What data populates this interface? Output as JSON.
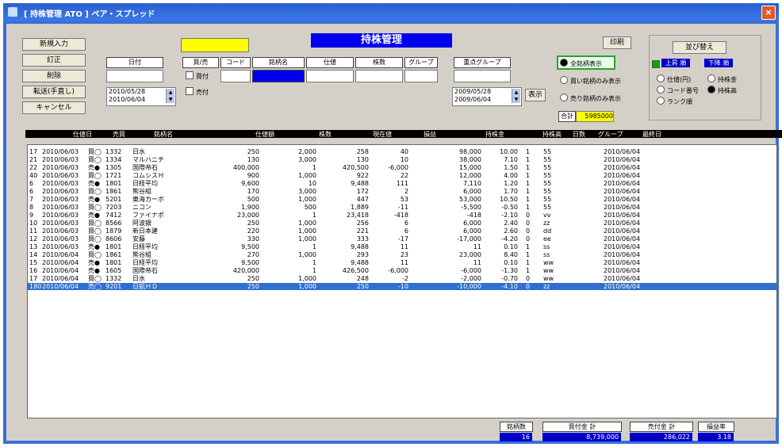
{
  "window": {
    "title": "[ 持株管理 ATO ]   ペア・スプレッド",
    "close": "×"
  },
  "left_buttons": [
    "新規入力",
    "訂正",
    "削除",
    "転送(手直し)",
    "キャンセル"
  ],
  "banner": "持株管理",
  "top_right": {
    "print_label": "印刷",
    "sort_label": "並び替え"
  },
  "filters": {
    "box1_label": "日付",
    "col_labels": [
      "買/売",
      "コード",
      "銘柄名",
      "仕値",
      "株数",
      "グループ"
    ],
    "box_right_label": "重点グループ",
    "check_buy": "買付",
    "check_sell": "売付",
    "date_left": [
      "2010/05/28",
      "2010/06/04"
    ],
    "date_right": [
      "2009/05/28",
      "2009/06/04"
    ],
    "btn_right": "表示"
  },
  "options": {
    "o1": "全銘柄表示",
    "o2": "買い銘柄のみ表示",
    "o3": "売り銘柄のみ表示",
    "sum_label": "合計",
    "sum_value": "5985000"
  },
  "sort_panel": {
    "btn1": "上昇 順",
    "btn2": "下降 順",
    "r1": "仕値(円)",
    "r2": "持株金",
    "r3": "コード番号",
    "r4": "持株高",
    "r5": "ランク順"
  },
  "columns": [
    "仕値日",
    "売買",
    "銘柄名",
    "仕値額",
    "株数",
    "現在値",
    "損益",
    "持株金",
    "持株高",
    "日数",
    "グループ",
    "最終日"
  ],
  "rows": [
    [
      "17",
      "2010/06/03",
      "買◯",
      "1332",
      "日水",
      "250",
      "2,000",
      "258",
      "40",
      "98,000",
      "10.00",
      "1",
      "55",
      "2010/06/04"
    ],
    [
      "21",
      "2010/06/03",
      "買◯",
      "1334",
      "マルハニチ",
      "130",
      "3,000",
      "130",
      "10",
      "38,000",
      "7.10",
      "1",
      "55",
      "2010/06/04"
    ],
    [
      "22",
      "2010/06/03",
      "売●",
      "1305",
      "国際帝石",
      "400,000",
      "1",
      "420,500",
      "-6,000",
      "15,000",
      "1.50",
      "1",
      "55",
      "2010/06/04"
    ],
    [
      "40",
      "2010/06/03",
      "買◯",
      "1721",
      "コムシスＨ",
      "900",
      "1,000",
      "922",
      "22",
      "12,000",
      "4.00",
      "1",
      "55",
      "2010/06/04"
    ],
    [
      "6",
      "2010/06/03",
      "売●",
      "1801",
      "日経平均",
      "9,600",
      "10",
      "9,488",
      "111",
      "7,110",
      "1.20",
      "1",
      "55",
      "2010/06/04"
    ],
    [
      "6",
      "2010/06/03",
      "買◯",
      "1861",
      "熊谷組",
      "170",
      "3,000",
      "172",
      "2",
      "6,000",
      "1.70",
      "1",
      "55",
      "2010/06/04"
    ],
    [
      "7",
      "2010/06/03",
      "売●",
      "5201",
      "東海カーボ",
      "500",
      "1,000",
      "447",
      "53",
      "53,000",
      "10.50",
      "1",
      "55",
      "2010/06/04"
    ],
    [
      "8",
      "2010/06/03",
      "買◯",
      "7203",
      "ニコン",
      "1,900",
      "500",
      "1,889",
      "-11",
      "-5,500",
      "-0.50",
      "1",
      "55",
      "2010/06/04"
    ],
    [
      "9",
      "2010/06/03",
      "売●",
      "7412",
      "ファイナポ",
      "23,000",
      "1",
      "23,418",
      "-418",
      "-418",
      "-2.10",
      "0",
      "vv",
      "2010/06/04"
    ],
    [
      "10",
      "2010/06/03",
      "買◯",
      "8566",
      "阿波銀",
      "250",
      "1,000",
      "256",
      "6",
      "6,000",
      "2.40",
      "0",
      "zz",
      "2010/06/04"
    ],
    [
      "11",
      "2010/06/03",
      "買◯",
      "1879",
      "新日本建",
      "220",
      "1,000",
      "221",
      "6",
      "6,000",
      "2.60",
      "0",
      "dd",
      "2010/06/04"
    ],
    [
      "12",
      "2010/06/03",
      "買◯",
      "8606",
      "安藤",
      "330",
      "1,000",
      "333",
      "-17",
      "-17,000",
      "-4.20",
      "0",
      "ee",
      "2010/06/04"
    ],
    [
      "13",
      "2010/06/03",
      "売●",
      "1801",
      "日経平均",
      "9,500",
      "1",
      "9,488",
      "11",
      "11",
      "0.10",
      "1",
      "ss",
      "2010/06/04"
    ],
    [
      "14",
      "2010/06/04",
      "買◯",
      "1861",
      "熊谷組",
      "270",
      "1,000",
      "293",
      "23",
      "23,000",
      "8.40",
      "1",
      "ss",
      "2010/06/04"
    ],
    [
      "15",
      "2010/06/04",
      "売●",
      "1801",
      "日経平均",
      "9,500",
      "1",
      "9,488",
      "11",
      "11",
      "0.10",
      "1",
      "ww",
      "2010/06/04"
    ],
    [
      "16",
      "2010/06/04",
      "売●",
      "1605",
      "国際帝石",
      "420,000",
      "1",
      "426,500",
      "-6,000",
      "-6,000",
      "-1.30",
      "1",
      "ww",
      "2010/06/04"
    ],
    [
      "17",
      "2010/06/04",
      "買◯",
      "1332",
      "日水",
      "250",
      "1,000",
      "248",
      "-2",
      "-2,000",
      "-0.70",
      "0",
      "ww",
      "2010/06/04"
    ],
    [
      "180",
      "2010/06/04",
      "売◯",
      "9201",
      "日航ＨＤ",
      "250",
      "1,000",
      "250",
      "-10",
      "-10,000",
      "-4.10",
      "0",
      "zz",
      "2010/06/04"
    ]
  ],
  "footer": {
    "labels": [
      "銘柄数",
      "買付金 計",
      "売付金 計",
      "損益率"
    ],
    "values": [
      "16",
      "8,739,000",
      "286,022",
      "3.18"
    ]
  }
}
